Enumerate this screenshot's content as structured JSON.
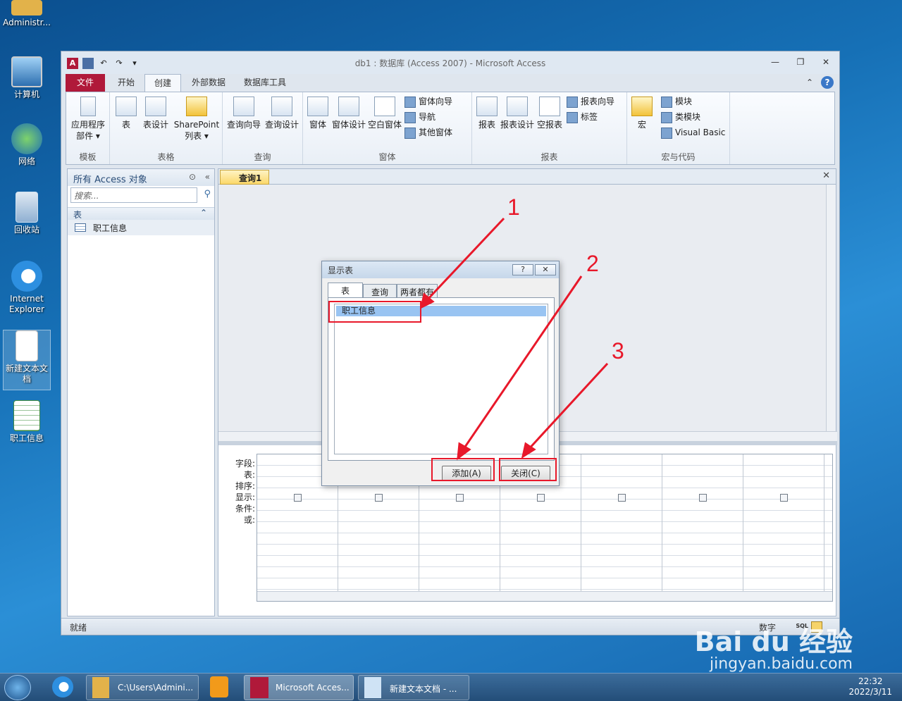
{
  "desktop": {
    "icons": [
      "Administr...",
      "计算机",
      "网络",
      "回收站",
      "Internet Explorer",
      "新建文本文档",
      "职工信息"
    ]
  },
  "window": {
    "title": "db1 : 数据库 (Access 2007)  -  Microsoft Access",
    "app_badge": "A"
  },
  "tabs": [
    "文件",
    "开始",
    "创建",
    "外部数据",
    "数据库工具"
  ],
  "ribbon": {
    "groups": [
      "模板",
      "表格",
      "查询",
      "窗体",
      "报表",
      "宏与代码"
    ],
    "buttons": {
      "app_parts": "应用程序部件",
      "table": "表",
      "table_design": "表设计",
      "sharepoint": "SharePoint列表",
      "query_wizard": "查询向导",
      "query_design": "查询设计",
      "form": "窗体",
      "form_design": "窗体设计",
      "blank_form": "空白窗体",
      "form_wizard": "窗体向导",
      "navigation": "导航",
      "more_forms": "其他窗体",
      "report": "报表",
      "report_design": "报表设计",
      "blank_report": "空报表",
      "report_wizard": "报表向导",
      "labels": "标签",
      "macro": "宏",
      "module": "模块",
      "class_module": "类模块",
      "vba": "Visual Basic"
    }
  },
  "nav": {
    "header": "所有 Access 对象",
    "search_placeholder": "搜索...",
    "category": "表",
    "items": [
      "职工信息"
    ]
  },
  "document": {
    "tab": "查询1",
    "row_labels": [
      "字段:",
      "表:",
      "排序:",
      "显示:",
      "条件:",
      "或:"
    ]
  },
  "dialog": {
    "title": "显示表",
    "help": "?",
    "close": "✕",
    "tabs": [
      "表",
      "查询",
      "两者都有"
    ],
    "list": [
      "职工信息"
    ],
    "add_button": "添加(A)",
    "close_button": "关闭(C)"
  },
  "annotations": [
    "1",
    "2",
    "3"
  ],
  "status": {
    "left": "就绪",
    "right": "数字",
    "sql": "SQL"
  },
  "taskbar": {
    "items": [
      "C:\\Users\\Admini...",
      "Microsoft Acces...",
      "新建文本文档 - ..."
    ],
    "time": "22:32",
    "date": "2022/3/11"
  },
  "watermark": {
    "brand": "Bai du 经验",
    "url": "jingyan.baidu.com"
  }
}
